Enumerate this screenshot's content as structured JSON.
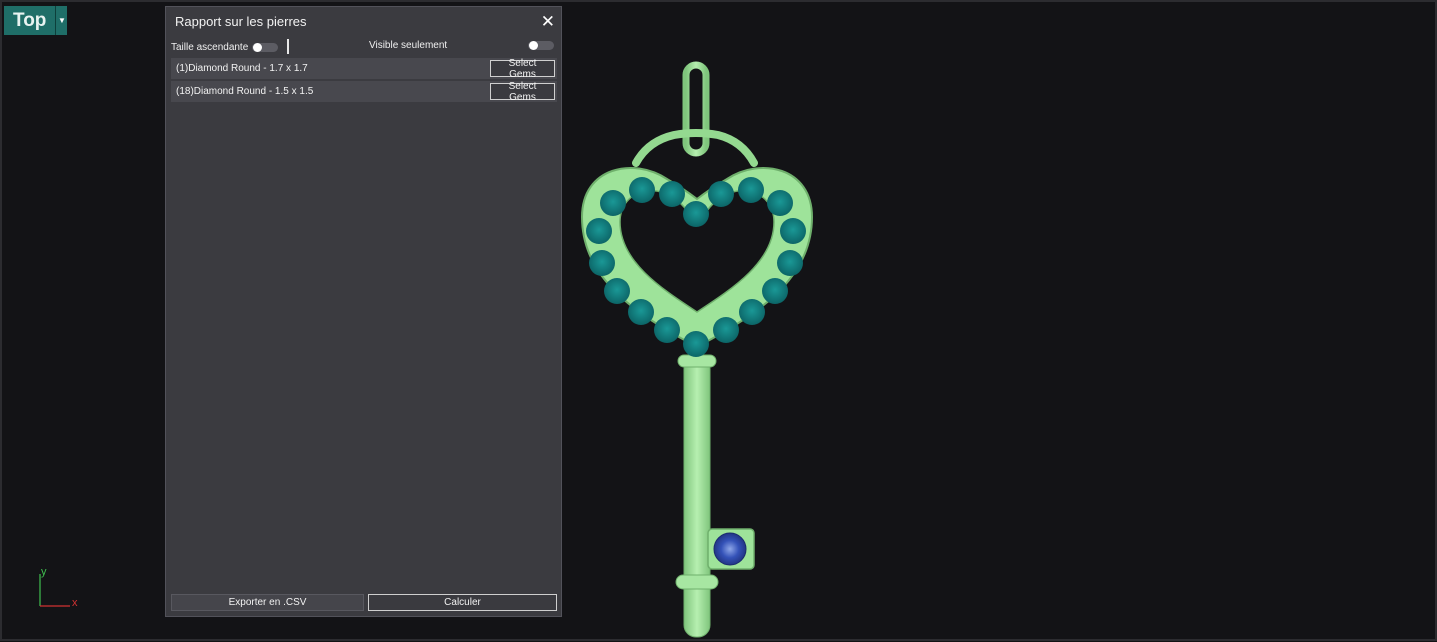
{
  "viewport": {
    "view_name": "Top",
    "axis": {
      "x_label": "x",
      "y_label": "y"
    }
  },
  "panel": {
    "title": "Rapport sur les pierres",
    "close_symbol": "✕",
    "filters": {
      "ascending_label": "Taille ascendante",
      "ascending_on": false,
      "visible_label": "Visible seulement",
      "visible_on": false
    },
    "gems": [
      {
        "label": "(1)Diamond Round - 1.7 x 1.7",
        "button": "Select Gems"
      },
      {
        "label": "(18)Diamond Round - 1.5 x 1.5",
        "button": "Select Gems"
      }
    ],
    "footer": {
      "export_label": "Exporter en .CSV",
      "calc_label": "Calculer"
    }
  },
  "colors": {
    "metal": "#9ee39a",
    "stone": "#107f80",
    "center_stone": "#2c45a8",
    "accent": "#1f6e68"
  }
}
